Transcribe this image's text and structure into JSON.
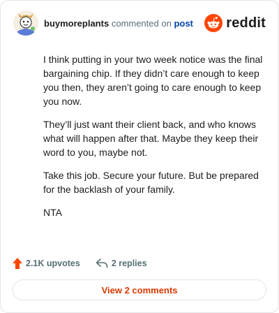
{
  "comment": {
    "username": "buymoreplants",
    "commented_on_text": "commented on",
    "post_link_label": "post",
    "body_paragraphs": [
      "I think putting in your two week notice was the final bargaining chip. If they didn’t care enough to keep you then, they aren’t going to care enough to keep you now.",
      "They’ll just want their client back, and who knows what will happen after that. Maybe they keep their word to you, maybe not.",
      "Take this job. Secure your future. But be prepared for the backlash of your family.",
      "NTA"
    ],
    "upvotes_label": "2.1K upvotes",
    "replies_label": "2 replies",
    "view_comments_label": "View 2 comments"
  },
  "brand": {
    "wordmark": "reddit",
    "accent_color": "#ff4500",
    "link_color": "#0045ac",
    "button_text_color": "#d93900"
  },
  "icons": {
    "upvote": "upvote-arrow-icon",
    "reply": "reply-arrow-icon",
    "logo": "reddit-snoo-icon"
  }
}
